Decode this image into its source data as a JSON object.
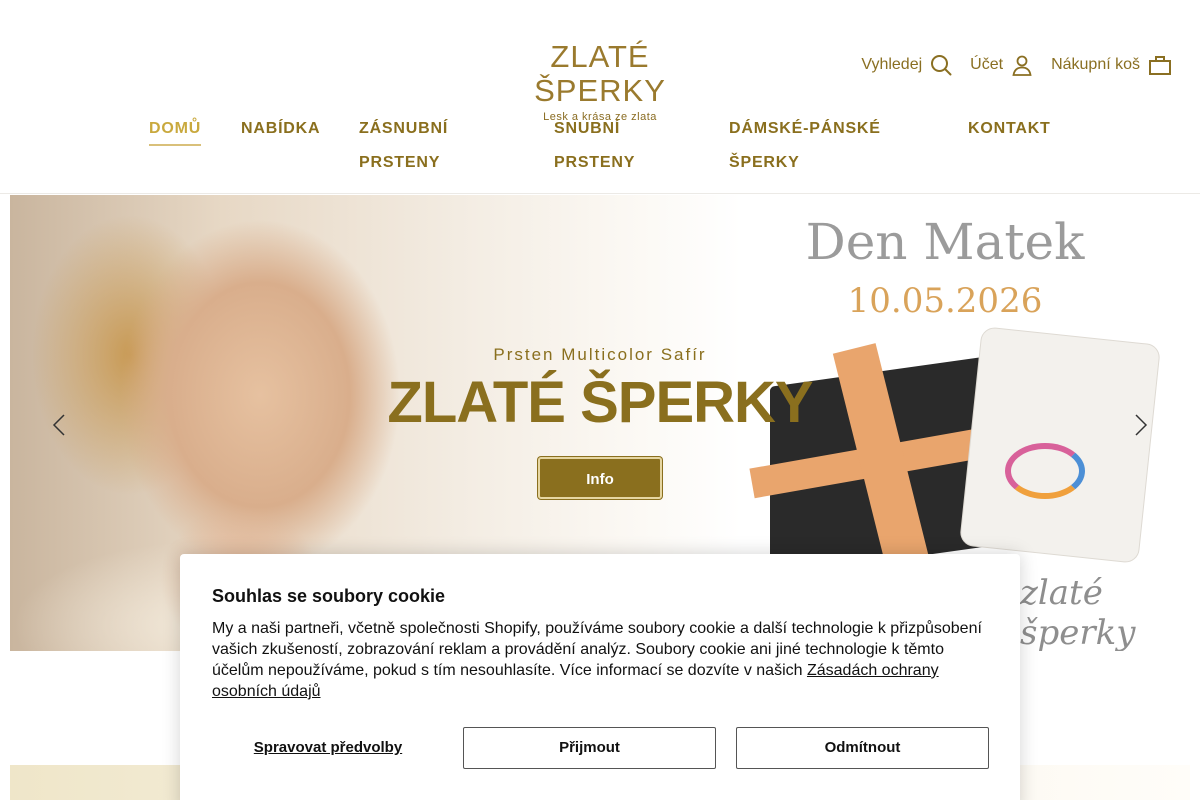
{
  "brand": {
    "title": "ZLATÉ ŠPERKY",
    "tagline": "Lesk a krása ze zlata",
    "accent_color": "#8a6f1e",
    "active_color": "#c9a93e"
  },
  "header": {
    "search_label": "Vyhledej",
    "search_icon": "search-icon",
    "account_label": "Účet",
    "account_icon": "user-icon",
    "cart_label": "Nákupní koš",
    "cart_icon": "shopping-bag-icon"
  },
  "nav": {
    "items": [
      {
        "label": "DOMŮ",
        "active": true
      },
      {
        "label": "NABÍDKA",
        "active": false
      },
      {
        "label": "ZÁSNUBNÍ PRSTENY",
        "line1": "ZÁSNUBNÍ",
        "line2": "PRSTENY",
        "active": false
      },
      {
        "label": "SNUBNÍ PRSTENY",
        "line1": "SNUBNÍ",
        "line2": "PRSTENY",
        "active": false
      },
      {
        "label": "DÁMSKÉ-PÁNSKÉ ŠPERKY",
        "line1": "DÁMSKÉ-PÁNSKÉ",
        "line2": "ŠPERKY",
        "active": false
      },
      {
        "label": "KONTAKT",
        "active": false
      }
    ]
  },
  "hero": {
    "subtitle": "Prsten Multicolor Safír",
    "title": "ZLATÉ ŠPERKY",
    "button_label": "Info",
    "image_text_heading": "Den Matek",
    "image_text_date": "10.05.2026",
    "image_text_script": "zlaté šperky",
    "prev_icon": "chevron-left-icon",
    "next_icon": "chevron-right-icon"
  },
  "cookie": {
    "title": "Souhlas se soubory cookie",
    "text": "My a naši partneři, včetně společnosti Shopify, používáme soubory cookie a další technologie k přizpůsobení vašich zkušeností, zobrazování reklam a provádění analýz. Soubory cookie ani jiné technologie k těmto účelům nepoužíváme, pokud s tím nesouhlasíte. Více informací se dozvíte v našich ",
    "link_text": "Zásadách ochrany osobních údajů",
    "manage_label": "Spravovat předvolby",
    "accept_label": "Přijmout",
    "reject_label": "Odmítnout"
  }
}
